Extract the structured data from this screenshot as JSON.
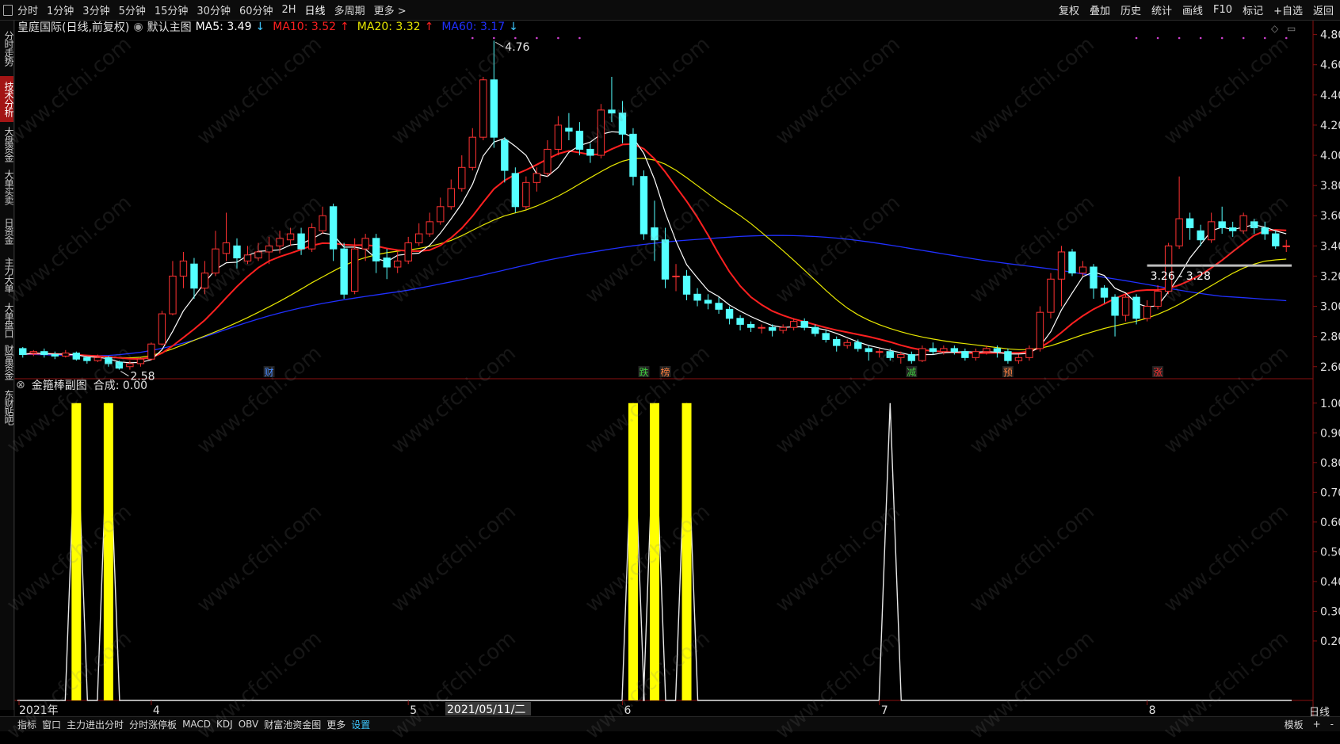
{
  "toolbar": {
    "items": [
      "分时",
      "1分钟",
      "3分钟",
      "5分钟",
      "15分钟",
      "30分钟",
      "60分钟",
      "2H",
      "日线",
      "多周期",
      "更多 >"
    ],
    "active_index": 8,
    "right_items": [
      "复权",
      "叠加",
      "历史",
      "统计",
      "画线",
      "F10",
      "标记",
      "+自选",
      "返回"
    ]
  },
  "sidebar": {
    "items": [
      "分时走势",
      "技术分析",
      "大盘资金",
      "大单买卖",
      "日资金",
      "主力大单",
      "大单盘口",
      "财富资金",
      "东财贴吧"
    ],
    "active_index": 1
  },
  "main_chart": {
    "stock_name": "皇庭国际(日线,前复权)",
    "template": "默认主图",
    "ma5": "MA5: 3.49",
    "ma5_arrow": "↓",
    "ma10": "MA10: 3.52",
    "ma10_arrow": "↑",
    "ma20": "MA20: 3.32",
    "ma20_arrow": "↑",
    "ma60": "MA60: 3.17",
    "ma60_arrow": "↓",
    "ma_colors": {
      "ma5": "#ffffff",
      "ma10": "#ff2020",
      "ma20": "#e8e800",
      "ma60": "#2030ff"
    },
    "high_label": "4.76",
    "low_label": "2.58",
    "range_label": "3.26 - 3.28",
    "event_tags": [
      {
        "text": "财",
        "color": "#4a8cff",
        "candle": 23
      },
      {
        "text": "跌",
        "color": "#40d040",
        "candle": 58
      },
      {
        "text": "榜",
        "color": "#ff8040",
        "candle": 60
      },
      {
        "text": "减",
        "color": "#40d040",
        "candle": 83
      },
      {
        "text": "预",
        "color": "#ff8040",
        "candle": 92
      },
      {
        "text": "涨",
        "color": "#ff3030",
        "candle": 106
      }
    ]
  },
  "price_axis": [
    "4.80",
    "4.60",
    "4.40",
    "4.20",
    "4.00",
    "3.80",
    "3.60",
    "3.40",
    "3.20",
    "3.00",
    "2.80",
    "2.60"
  ],
  "sub_chart": {
    "title": "金箍棒副图",
    "value": "合成: 0.00",
    "axis": [
      "1.00",
      "0.90",
      "0.80",
      "0.70",
      "0.60",
      "0.50",
      "0.40",
      "0.30",
      "0.20"
    ],
    "bar_color": "#ffff00"
  },
  "time_axis": {
    "labels": [
      {
        "text": "2021年",
        "candle": 0
      },
      {
        "text": "4",
        "candle": 12
      },
      {
        "text": "5",
        "candle": 36
      },
      {
        "text": "6",
        "candle": 56
      },
      {
        "text": "7",
        "candle": 80
      },
      {
        "text": "8",
        "candle": 105
      }
    ],
    "cursor_date": "2021/05/11/二"
  },
  "bottom_tabs": [
    "指标",
    "窗口",
    "主力进出分时",
    "分时涨停板",
    "MACD",
    "KDJ",
    "OBV",
    "财富池资金图",
    "更多",
    "设置"
  ],
  "bottom_active_index": 9,
  "bottom_right": [
    "模板",
    "+",
    "-"
  ],
  "period": "日线",
  "watermark": "www.cfchi.com",
  "chart_data": [
    {
      "type": "candlestick",
      "title": "皇庭国际(日线,前复权)",
      "ylim": [
        2.52,
        4.84
      ],
      "series": [
        {
          "name": "K",
          "values": [
            [
              2.72,
              2.68,
              2.73,
              2.66
            ],
            [
              2.69,
              2.7,
              2.71,
              2.67
            ],
            [
              2.7,
              2.68,
              2.72,
              2.66
            ],
            [
              2.68,
              2.67,
              2.7,
              2.65
            ],
            [
              2.67,
              2.69,
              2.71,
              2.66
            ],
            [
              2.69,
              2.65,
              2.7,
              2.64
            ],
            [
              2.66,
              2.64,
              2.67,
              2.62
            ],
            [
              2.64,
              2.66,
              2.68,
              2.63
            ],
            [
              2.66,
              2.62,
              2.67,
              2.6
            ],
            [
              2.63,
              2.59,
              2.64,
              2.58
            ],
            [
              2.6,
              2.62,
              2.64,
              2.58
            ],
            [
              2.62,
              2.65,
              2.66,
              2.6
            ],
            [
              2.65,
              2.75,
              2.76,
              2.64
            ],
            [
              2.75,
              2.95,
              2.97,
              2.74
            ],
            [
              2.95,
              3.2,
              3.3,
              2.94
            ],
            [
              3.2,
              3.3,
              3.36,
              3.12
            ],
            [
              3.28,
              3.12,
              3.32,
              3.05
            ],
            [
              3.12,
              3.22,
              3.3,
              3.08
            ],
            [
              3.22,
              3.38,
              3.5,
              3.2
            ],
            [
              3.35,
              3.42,
              3.62,
              3.3
            ],
            [
              3.4,
              3.32,
              3.45,
              3.25
            ],
            [
              3.3,
              3.34,
              3.4,
              3.28
            ],
            [
              3.32,
              3.36,
              3.42,
              3.3
            ],
            [
              3.36,
              3.4,
              3.46,
              3.28
            ],
            [
              3.4,
              3.45,
              3.5,
              3.35
            ],
            [
              3.44,
              3.48,
              3.52,
              3.4
            ],
            [
              3.48,
              3.38,
              3.52,
              3.34
            ],
            [
              3.38,
              3.52,
              3.55,
              3.36
            ],
            [
              3.5,
              3.6,
              3.66,
              3.48
            ],
            [
              3.66,
              3.38,
              3.68,
              3.3
            ],
            [
              3.38,
              3.08,
              3.42,
              3.05
            ],
            [
              3.1,
              3.38,
              3.45,
              3.08
            ],
            [
              3.38,
              3.45,
              3.48,
              3.3
            ],
            [
              3.45,
              3.3,
              3.48,
              3.22
            ],
            [
              3.32,
              3.26,
              3.38,
              3.18
            ],
            [
              3.26,
              3.3,
              3.36,
              3.22
            ],
            [
              3.3,
              3.42,
              3.46,
              3.28
            ],
            [
              3.42,
              3.48,
              3.55,
              3.4
            ],
            [
              3.48,
              3.56,
              3.62,
              3.46
            ],
            [
              3.56,
              3.66,
              3.72,
              3.54
            ],
            [
              3.66,
              3.78,
              3.84,
              3.64
            ],
            [
              3.78,
              3.92,
              4.0,
              3.76
            ],
            [
              3.92,
              4.12,
              4.18,
              3.9
            ],
            [
              4.12,
              4.5,
              4.52,
              4.1
            ],
            [
              4.5,
              4.12,
              4.76,
              4.05
            ],
            [
              4.1,
              3.9,
              4.12,
              3.82
            ],
            [
              3.88,
              3.66,
              3.92,
              3.62
            ],
            [
              3.66,
              3.82,
              3.86,
              3.64
            ],
            [
              3.82,
              3.88,
              3.92,
              3.76
            ],
            [
              3.88,
              4.04,
              4.1,
              3.86
            ],
            [
              4.04,
              4.2,
              4.26,
              4.0
            ],
            [
              4.18,
              4.16,
              4.28,
              4.1
            ],
            [
              4.16,
              4.04,
              4.22,
              4.0
            ],
            [
              4.04,
              4.0,
              4.08,
              3.95
            ],
            [
              4.0,
              4.3,
              4.34,
              3.98
            ],
            [
              4.3,
              4.28,
              4.52,
              4.22
            ],
            [
              4.28,
              4.14,
              4.36,
              4.08
            ],
            [
              4.14,
              3.86,
              4.18,
              3.8
            ],
            [
              3.86,
              3.48,
              3.9,
              3.44
            ],
            [
              3.52,
              3.44,
              3.7,
              3.3
            ],
            [
              3.44,
              3.18,
              3.52,
              3.12
            ],
            [
              3.2,
              3.2,
              3.28,
              3.1
            ],
            [
              3.2,
              3.08,
              3.24,
              3.04
            ],
            [
              3.08,
              3.04,
              3.12,
              3.0
            ],
            [
              3.04,
              3.02,
              3.08,
              2.98
            ],
            [
              3.02,
              2.98,
              3.06,
              2.95
            ],
            [
              2.98,
              2.92,
              3.0,
              2.88
            ],
            [
              2.92,
              2.88,
              2.94,
              2.84
            ],
            [
              2.88,
              2.86,
              2.9,
              2.83
            ],
            [
              2.86,
              2.86,
              2.88,
              2.82
            ],
            [
              2.86,
              2.84,
              2.88,
              2.8
            ],
            [
              2.84,
              2.86,
              2.88,
              2.82
            ],
            [
              2.86,
              2.9,
              2.92,
              2.84
            ],
            [
              2.9,
              2.86,
              2.92,
              2.84
            ],
            [
              2.86,
              2.82,
              2.88,
              2.8
            ],
            [
              2.82,
              2.78,
              2.84,
              2.76
            ],
            [
              2.78,
              2.74,
              2.8,
              2.7
            ],
            [
              2.74,
              2.76,
              2.78,
              2.72
            ],
            [
              2.76,
              2.72,
              2.78,
              2.7
            ],
            [
              2.72,
              2.7,
              2.74,
              2.64
            ],
            [
              2.7,
              2.7,
              2.72,
              2.66
            ],
            [
              2.7,
              2.66,
              2.72,
              2.64
            ],
            [
              2.66,
              2.68,
              2.7,
              2.62
            ],
            [
              2.68,
              2.64,
              2.7,
              2.62
            ],
            [
              2.64,
              2.72,
              2.74,
              2.63
            ],
            [
              2.72,
              2.7,
              2.76,
              2.68
            ],
            [
              2.7,
              2.72,
              2.74,
              2.68
            ],
            [
              2.72,
              2.7,
              2.74,
              2.68
            ],
            [
              2.7,
              2.66,
              2.72,
              2.64
            ],
            [
              2.66,
              2.7,
              2.72,
              2.64
            ],
            [
              2.7,
              2.72,
              2.74,
              2.68
            ],
            [
              2.72,
              2.7,
              2.74,
              2.66
            ],
            [
              2.7,
              2.64,
              2.72,
              2.62
            ],
            [
              2.64,
              2.66,
              2.68,
              2.62
            ],
            [
              2.66,
              2.72,
              2.74,
              2.64
            ],
            [
              2.72,
              2.96,
              3.0,
              2.7
            ],
            [
              2.96,
              3.18,
              3.22,
              2.92
            ],
            [
              3.18,
              3.36,
              3.4,
              3.0
            ],
            [
              3.36,
              3.22,
              3.38,
              3.2
            ],
            [
              3.22,
              3.26,
              3.3,
              3.2
            ],
            [
              3.26,
              3.12,
              3.28,
              3.05
            ],
            [
              3.12,
              3.06,
              3.14,
              3.02
            ],
            [
              3.06,
              2.94,
              3.08,
              2.8
            ],
            [
              2.94,
              3.06,
              3.08,
              2.9
            ],
            [
              3.06,
              2.92,
              3.08,
              2.88
            ],
            [
              2.92,
              3.0,
              3.04,
              2.9
            ],
            [
              3.0,
              3.1,
              3.14,
              2.98
            ],
            [
              3.1,
              3.4,
              3.42,
              3.08
            ],
            [
              3.4,
              3.58,
              3.86,
              3.38
            ],
            [
              3.58,
              3.52,
              3.62,
              3.44
            ],
            [
              3.5,
              3.44,
              3.54,
              3.4
            ],
            [
              3.44,
              3.56,
              3.62,
              3.42
            ],
            [
              3.56,
              3.52,
              3.66,
              3.48
            ],
            [
              3.52,
              3.5,
              3.56,
              3.46
            ],
            [
              3.5,
              3.6,
              3.62,
              3.48
            ],
            [
              3.56,
              3.52,
              3.58,
              3.48
            ],
            [
              3.52,
              3.48,
              3.56,
              3.44
            ],
            [
              3.48,
              3.4,
              3.5,
              3.38
            ],
            [
              3.4,
              3.4,
              3.44,
              3.36
            ]
          ]
        },
        {
          "name": "MA5",
          "values": []
        },
        {
          "name": "MA10",
          "values": []
        },
        {
          "name": "MA20",
          "values": []
        },
        {
          "name": "MA60",
          "values": []
        }
      ]
    },
    {
      "type": "bar",
      "title": "金箍棒副图",
      "ylim": [
        0,
        1.05
      ],
      "series": [
        {
          "name": "金箍棒",
          "bars": [
            {
              "candle": 5,
              "value": 1.0
            },
            {
              "candle": 8,
              "value": 1.0
            },
            {
              "candle": 57,
              "value": 1.0
            },
            {
              "candle": 59,
              "value": 1.0
            },
            {
              "candle": 62,
              "value": 1.0
            }
          ]
        },
        {
          "name": "合成",
          "spikes": [
            {
              "candle": 5,
              "value": 1.0
            },
            {
              "candle": 8,
              "value": 1.0
            },
            {
              "candle": 57,
              "value": 1.0
            },
            {
              "candle": 59,
              "value": 1.0
            },
            {
              "candle": 62,
              "value": 1.0
            },
            {
              "candle": 81,
              "value": 1.0
            }
          ]
        }
      ]
    }
  ]
}
